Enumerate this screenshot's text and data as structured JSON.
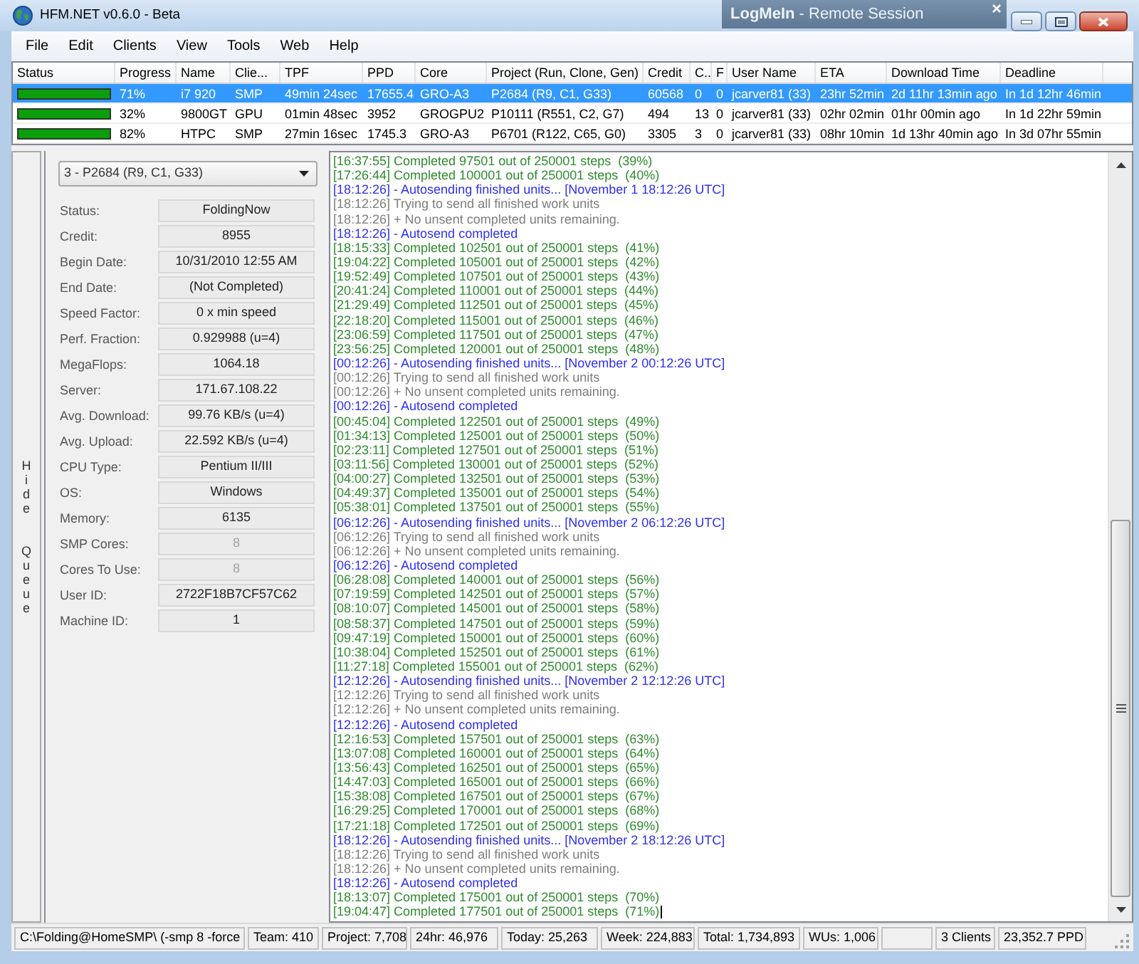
{
  "window": {
    "title": "HFM.NET v0.6.0 - Beta"
  },
  "remote_banner": {
    "title": "**LogMeIn** - Remote Session"
  },
  "menu": [
    "File",
    "Edit",
    "Clients",
    "View",
    "Tools",
    "Web",
    "Help"
  ],
  "table": {
    "columns": [
      "Status",
      "Progress",
      "Name",
      "Clie...",
      "TPF",
      "PPD",
      "Core",
      "Project (Run, Clone, Gen)",
      "Credit",
      "C..",
      "F",
      "User Name",
      "ETA",
      "Download Time",
      "Deadline"
    ],
    "rows": [
      {
        "selected": true,
        "cells": [
          {
            "color": "#0c9e0c"
          },
          "71%",
          "i7 920",
          "SMP",
          "49min 24sec",
          "17655.4",
          "GRO-A3",
          "P2684 (R9, C1, G33)",
          "60568",
          "0",
          "0",
          "jcarver81 (33)",
          "23hr 52min",
          "2d 11hr 13min ago",
          "In 1d 12hr 46min"
        ]
      },
      {
        "selected": false,
        "cells": [
          {
            "color": "#0c9e0c"
          },
          "32%",
          "9800GT",
          "GPU",
          "01min 48sec",
          "3952",
          "GROGPU2",
          "P10111 (R551, C2, G7)",
          "494",
          "13",
          "0",
          "jcarver81 (33)",
          "02hr 02min",
          "01hr 00min ago",
          "In 1d 22hr 59min"
        ]
      },
      {
        "selected": false,
        "cells": [
          {
            "color": "#0c9e0c"
          },
          "82%",
          "HTPC",
          "SMP",
          "27min 16sec",
          "1745.3",
          "GRO-A3",
          "P6701 (R122, C65, G0)",
          "3305",
          "3",
          "0",
          "jcarver81 (33)",
          "08hr 10min",
          "1d 13hr 40min ago",
          "In 3d 07hr 55min"
        ]
      }
    ]
  },
  "queue_toggle": {
    "label": "Hide Queue"
  },
  "work_unit": {
    "selector": "3 - P2684 (R9, C1, G33)",
    "fields": [
      {
        "label": "Status:",
        "value": "FoldingNow",
        "disabled": false
      },
      {
        "label": "Credit:",
        "value": "8955",
        "disabled": false
      },
      {
        "label": "Begin Date:",
        "value": "10/31/2010 12:55 AM",
        "disabled": false
      },
      {
        "label": "End Date:",
        "value": "(Not Completed)",
        "disabled": false
      },
      {
        "label": "Speed Factor:",
        "value": "0 x min speed",
        "disabled": false
      },
      {
        "label": "Perf. Fraction:",
        "value": "0.929988 (u=4)",
        "disabled": false
      },
      {
        "label": "MegaFlops:",
        "value": "1064.18",
        "disabled": false
      },
      {
        "label": "Server:",
        "value": "171.67.108.22",
        "disabled": false
      },
      {
        "label": "Avg. Download:",
        "value": "99.76 KB/s (u=4)",
        "disabled": false
      },
      {
        "label": "Avg. Upload:",
        "value": "22.592 KB/s (u=4)",
        "disabled": false
      },
      {
        "label": "CPU Type:",
        "value": "Pentium II/III",
        "disabled": false
      },
      {
        "label": "OS:",
        "value": "Windows",
        "disabled": false
      },
      {
        "label": "Memory:",
        "value": "6135",
        "disabled": false
      },
      {
        "label": "SMP Cores:",
        "value": "8",
        "disabled": true
      },
      {
        "label": "Cores To Use:",
        "value": "8",
        "disabled": true
      },
      {
        "label": "User ID:",
        "value": "2722F18B7CF57C62",
        "disabled": false
      },
      {
        "label": "Machine ID:",
        "value": "1",
        "disabled": false
      }
    ]
  },
  "log": {
    "lines": [
      {
        "kind": "progress",
        "text": "[16:37:55] Completed 97501 out of 250001 steps  (39%)"
      },
      {
        "kind": "progress",
        "text": "[17:26:44] Completed 100001 out of 250001 steps  (40%)"
      },
      {
        "kind": "autosend",
        "text": "[18:12:26] - Autosending finished units... [November 1 18:12:26 UTC]"
      },
      {
        "kind": "info",
        "text": "[18:12:26] Trying to send all finished work units"
      },
      {
        "kind": "info",
        "text": "[18:12:26] + No unsent completed units remaining."
      },
      {
        "kind": "autosend",
        "text": "[18:12:26] - Autosend completed"
      },
      {
        "kind": "progress",
        "text": "[18:15:33] Completed 102501 out of 250001 steps  (41%)"
      },
      {
        "kind": "progress",
        "text": "[19:04:22] Completed 105001 out of 250001 steps  (42%)"
      },
      {
        "kind": "progress",
        "text": "[19:52:49] Completed 107501 out of 250001 steps  (43%)"
      },
      {
        "kind": "progress",
        "text": "[20:41:24] Completed 110001 out of 250001 steps  (44%)"
      },
      {
        "kind": "progress",
        "text": "[21:29:49] Completed 112501 out of 250001 steps  (45%)"
      },
      {
        "kind": "progress",
        "text": "[22:18:20] Completed 115001 out of 250001 steps  (46%)"
      },
      {
        "kind": "progress",
        "text": "[23:06:59] Completed 117501 out of 250001 steps  (47%)"
      },
      {
        "kind": "progress",
        "text": "[23:56:25] Completed 120001 out of 250001 steps  (48%)"
      },
      {
        "kind": "autosend",
        "text": "[00:12:26] - Autosending finished units... [November 2 00:12:26 UTC]"
      },
      {
        "kind": "info",
        "text": "[00:12:26] Trying to send all finished work units"
      },
      {
        "kind": "info",
        "text": "[00:12:26] + No unsent completed units remaining."
      },
      {
        "kind": "autosend",
        "text": "[00:12:26] - Autosend completed"
      },
      {
        "kind": "progress",
        "text": "[00:45:04] Completed 122501 out of 250001 steps  (49%)"
      },
      {
        "kind": "progress",
        "text": "[01:34:13] Completed 125001 out of 250001 steps  (50%)"
      },
      {
        "kind": "progress",
        "text": "[02:23:11] Completed 127501 out of 250001 steps  (51%)"
      },
      {
        "kind": "progress",
        "text": "[03:11:56] Completed 130001 out of 250001 steps  (52%)"
      },
      {
        "kind": "progress",
        "text": "[04:00:27] Completed 132501 out of 250001 steps  (53%)"
      },
      {
        "kind": "progress",
        "text": "[04:49:37] Completed 135001 out of 250001 steps  (54%)"
      },
      {
        "kind": "progress",
        "text": "[05:38:01] Completed 137501 out of 250001 steps  (55%)"
      },
      {
        "kind": "autosend",
        "text": "[06:12:26] - Autosending finished units... [November 2 06:12:26 UTC]"
      },
      {
        "kind": "info",
        "text": "[06:12:26] Trying to send all finished work units"
      },
      {
        "kind": "info",
        "text": "[06:12:26] + No unsent completed units remaining."
      },
      {
        "kind": "autosend",
        "text": "[06:12:26] - Autosend completed"
      },
      {
        "kind": "progress",
        "text": "[06:28:08] Completed 140001 out of 250001 steps  (56%)"
      },
      {
        "kind": "progress",
        "text": "[07:19:59] Completed 142501 out of 250001 steps  (57%)"
      },
      {
        "kind": "progress",
        "text": "[08:10:07] Completed 145001 out of 250001 steps  (58%)"
      },
      {
        "kind": "progress",
        "text": "[08:58:37] Completed 147501 out of 250001 steps  (59%)"
      },
      {
        "kind": "progress",
        "text": "[09:47:19] Completed 150001 out of 250001 steps  (60%)"
      },
      {
        "kind": "progress",
        "text": "[10:38:04] Completed 152501 out of 250001 steps  (61%)"
      },
      {
        "kind": "progress",
        "text": "[11:27:18] Completed 155001 out of 250001 steps  (62%)"
      },
      {
        "kind": "autosend",
        "text": "[12:12:26] - Autosending finished units... [November 2 12:12:26 UTC]"
      },
      {
        "kind": "info",
        "text": "[12:12:26] Trying to send all finished work units"
      },
      {
        "kind": "info",
        "text": "[12:12:26] + No unsent completed units remaining."
      },
      {
        "kind": "autosend",
        "text": "[12:12:26] - Autosend completed"
      },
      {
        "kind": "progress",
        "text": "[12:16:53] Completed 157501 out of 250001 steps  (63%)"
      },
      {
        "kind": "progress",
        "text": "[13:07:08] Completed 160001 out of 250001 steps  (64%)"
      },
      {
        "kind": "progress",
        "text": "[13:56:43] Completed 162501 out of 250001 steps  (65%)"
      },
      {
        "kind": "progress",
        "text": "[14:47:03] Completed 165001 out of 250001 steps  (66%)"
      },
      {
        "kind": "progress",
        "text": "[15:38:08] Completed 167501 out of 250001 steps  (67%)"
      },
      {
        "kind": "progress",
        "text": "[16:29:25] Completed 170001 out of 250001 steps  (68%)"
      },
      {
        "kind": "progress",
        "text": "[17:21:18] Completed 172501 out of 250001 steps  (69%)"
      },
      {
        "kind": "autosend",
        "text": "[18:12:26] - Autosending finished units... [November 2 18:12:26 UTC]"
      },
      {
        "kind": "info",
        "text": "[18:12:26] Trying to send all finished work units"
      },
      {
        "kind": "info",
        "text": "[18:12:26] + No unsent completed units remaining."
      },
      {
        "kind": "autosend",
        "text": "[18:12:26] - Autosend completed"
      },
      {
        "kind": "progress",
        "text": "[18:13:07] Completed 175001 out of 250001 steps  (70%)"
      },
      {
        "kind": "progress",
        "text": "[19:04:47] Completed 177501 out of 250001 steps  (71%)"
      }
    ]
  },
  "status_bar": {
    "left": [
      "C:\\Folding@HomeSMP\\ (-smp 8 -force",
      "Team: 410",
      "Project: 7,708",
      "24hr: 46,976",
      "Today: 25,263",
      "Week: 224,883",
      "Total: 1,734,893",
      "WUs: 1,006"
    ],
    "right": [
      "3 Clients",
      "23,352.7 PPD"
    ]
  }
}
